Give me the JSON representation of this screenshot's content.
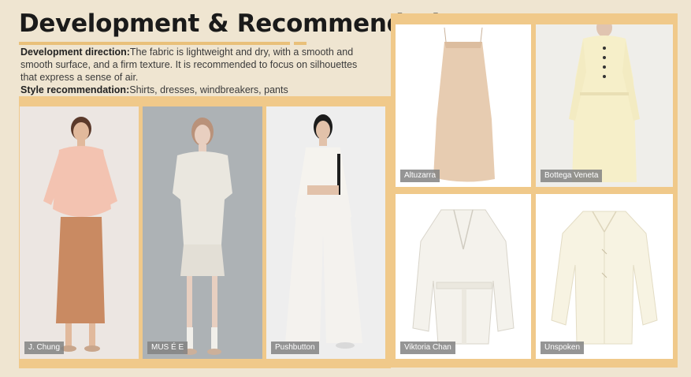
{
  "header": {
    "title": "Development & Recommendation",
    "development_label": "Development direction:",
    "development_text_1": "The fabric is lightweight and dry, with a smooth and",
    "development_text_2": "smooth surface, and a firm texture. It is recommended to focus on silhouettes",
    "development_text_3": "that express a sense of air.",
    "style_label": "Style recommendation:",
    "style_text": "Shirts, dresses, windbreakers, pants"
  },
  "looks": [
    {
      "brand": "J. Chung"
    },
    {
      "brand": "MUS É E"
    },
    {
      "brand": "Pushbutton"
    }
  ],
  "products": [
    {
      "brand": "Altuzarra"
    },
    {
      "brand": "Bottega Veneta"
    },
    {
      "brand": "Viktoria Chan"
    },
    {
      "brand": "Unspoken"
    }
  ],
  "colors": {
    "background": "#efe5d1",
    "accent": "#f0c98a",
    "label_bg": "#828282"
  }
}
